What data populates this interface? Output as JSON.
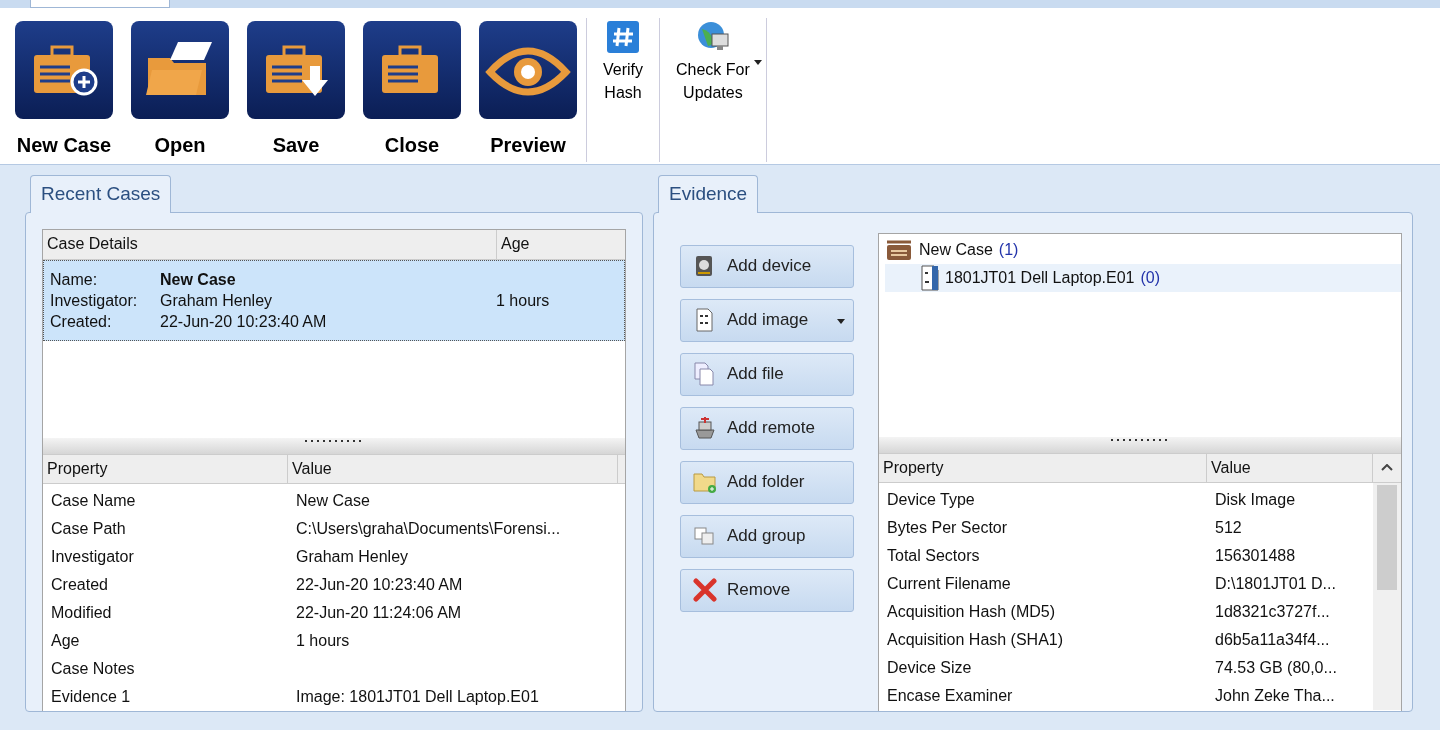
{
  "ribbon": {
    "large_buttons": [
      {
        "label": "New Case"
      },
      {
        "label": "Open"
      },
      {
        "label": "Save"
      },
      {
        "label": "Close"
      },
      {
        "label": "Preview"
      }
    ],
    "small_buttons": [
      {
        "lines": [
          "Verify",
          "Hash"
        ],
        "dropdown": false
      },
      {
        "lines": [
          "Check For",
          "Updates"
        ],
        "dropdown": true
      }
    ]
  },
  "recent_cases": {
    "tab": "Recent Cases",
    "columns": [
      "Case Details",
      "Age"
    ],
    "rows": [
      {
        "selected": true,
        "fields": [
          {
            "label": "Name:",
            "value": "New Case"
          },
          {
            "label": "Investigator:",
            "value": "Graham Henley"
          },
          {
            "label": "Created:",
            "value": "22-Jun-20 10:23:40 AM"
          }
        ],
        "age": "1 hours"
      }
    ],
    "properties": {
      "columns": [
        "Property",
        "Value"
      ],
      "rows": [
        [
          "Case Name",
          "New Case"
        ],
        [
          "Case Path",
          "C:\\Users\\graha\\Documents\\Forensi..."
        ],
        [
          "Investigator",
          "Graham Henley"
        ],
        [
          "Created",
          "22-Jun-20 10:23:40 AM"
        ],
        [
          "Modified",
          "22-Jun-20 11:24:06 AM"
        ],
        [
          "Age",
          "1 hours"
        ],
        [
          "Case Notes",
          ""
        ],
        [
          "Evidence 1",
          "Image: 1801JT01 Dell Laptop.E01"
        ]
      ]
    }
  },
  "evidence": {
    "tab": "Evidence",
    "buttons": [
      {
        "label": "Add device",
        "dropdown": false
      },
      {
        "label": "Add image",
        "dropdown": true
      },
      {
        "label": "Add file",
        "dropdown": false
      },
      {
        "label": "Add remote",
        "dropdown": false
      },
      {
        "label": "Add folder",
        "dropdown": false
      },
      {
        "label": "Add group",
        "dropdown": false
      },
      {
        "label": "Remove",
        "dropdown": false
      }
    ],
    "tree": [
      {
        "label": "New Case",
        "count": "(1)",
        "selected": false,
        "children": [
          {
            "label": "1801JT01 Dell Laptop.E01",
            "count": "(0)",
            "selected": true
          }
        ]
      }
    ],
    "properties": {
      "columns": [
        "Property",
        "Value"
      ],
      "rows": [
        [
          "Device Type",
          "Disk Image"
        ],
        [
          "Bytes Per Sector",
          "512"
        ],
        [
          "Total Sectors",
          "156301488"
        ],
        [
          "Current Filename",
          "D:\\1801JT01 D..."
        ],
        [
          "Acquisition Hash (MD5)",
          "1d8321c3727f..."
        ],
        [
          "Acquisition Hash (SHA1)",
          "d6b5a11a34f4..."
        ],
        [
          "Device Size",
          "74.53 GB (80,0..."
        ],
        [
          "Encase Examiner",
          "John Zeke Tha..."
        ]
      ]
    }
  }
}
